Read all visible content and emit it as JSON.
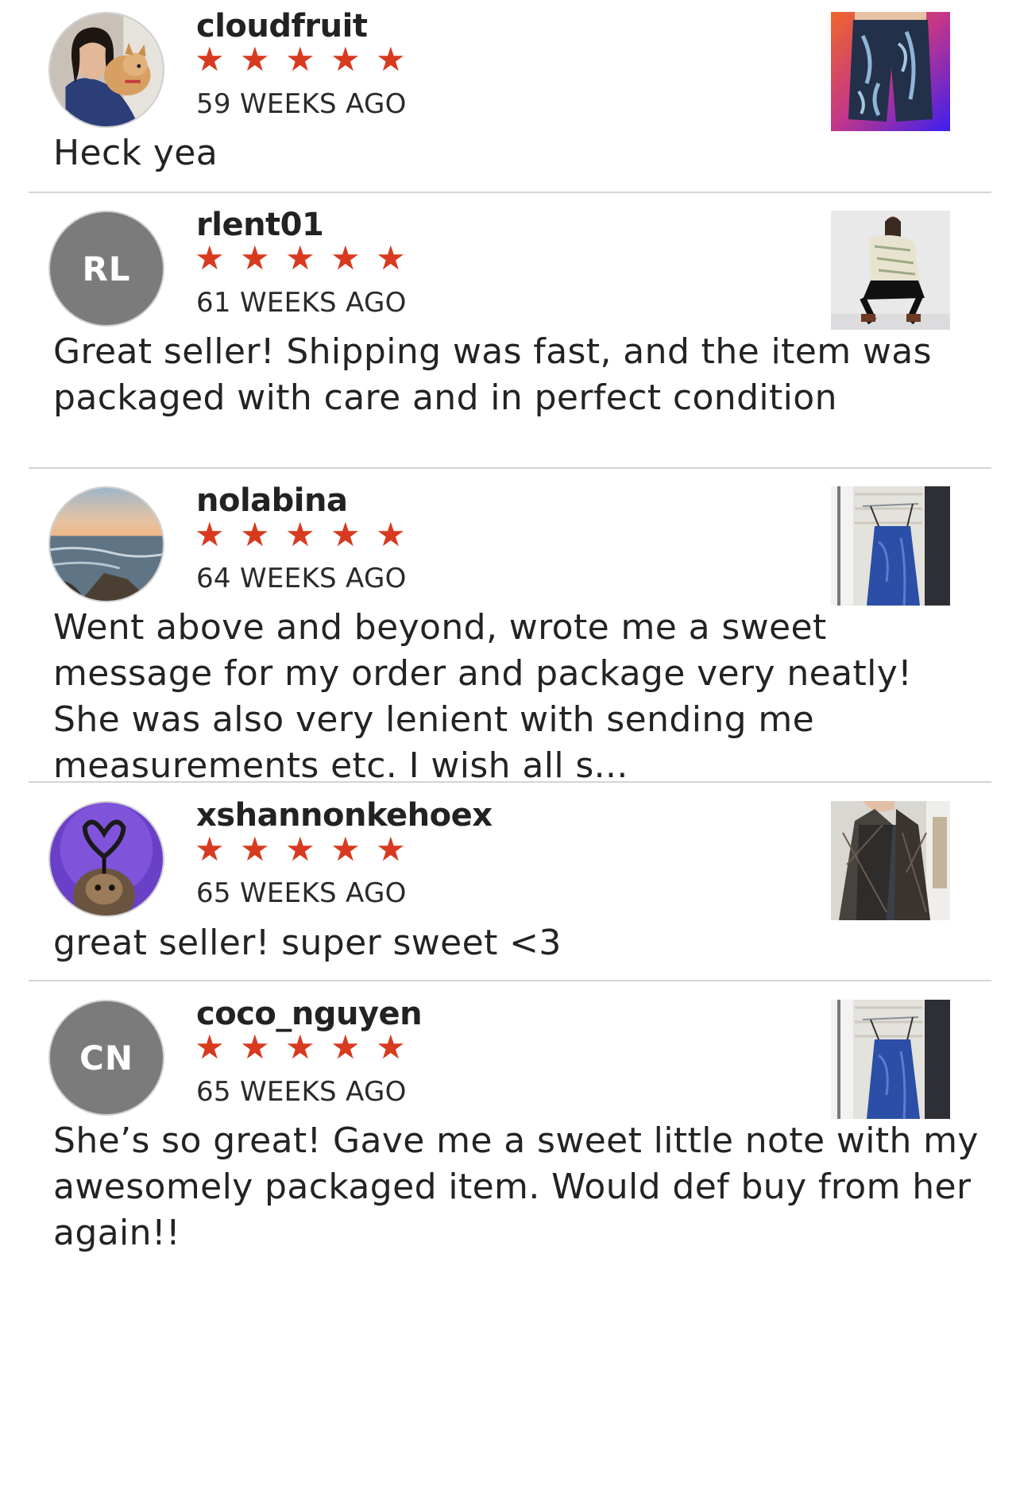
{
  "reviews": [
    {
      "username": "cloudfruit",
      "avatar": {
        "type": "photo",
        "icon": "profile-photo-girl-with-dog-icon"
      },
      "rating": 5,
      "stars": [
        "★",
        "★",
        "★",
        "★",
        "★"
      ],
      "date": "59 WEEKS AGO",
      "text": "Heck yea",
      "item_thumbnail": "item-photo-printed-shorts-icon"
    },
    {
      "username": "rlent01",
      "avatar": {
        "type": "initials",
        "initials": "RL",
        "color": "#7b7b7b"
      },
      "rating": 5,
      "stars": [
        "★",
        "★",
        "★",
        "★",
        "★"
      ],
      "date": "61 WEEKS AGO",
      "text": "Great seller! Shipping was fast, and the item was packaged with care and in perfect condition",
      "item_thumbnail": "item-photo-model-crouching-icon"
    },
    {
      "username": "nolabina",
      "avatar": {
        "type": "photo",
        "icon": "profile-photo-sunset-ocean-icon"
      },
      "rating": 5,
      "stars": [
        "★",
        "★",
        "★",
        "★",
        "★"
      ],
      "date": "64 WEEKS AGO",
      "text": "Went above and beyond, wrote me a sweet message for my order and package very neatly! She was also very lenient with sending me measurements etc. I wish all s...",
      "item_thumbnail": "item-photo-blue-slip-dress-icon"
    },
    {
      "username": "xshannonkehoex",
      "avatar": {
        "type": "photo",
        "icon": "profile-photo-purple-heart-icon"
      },
      "rating": 5,
      "stars": [
        "★",
        "★",
        "★",
        "★",
        "★"
      ],
      "date": "65 WEEKS AGO",
      "text": "great seller! super sweet <3",
      "item_thumbnail": "item-photo-knit-cardigan-icon"
    },
    {
      "username": "coco_nguyen",
      "avatar": {
        "type": "initials",
        "initials": "CN",
        "color": "#7b7b7b"
      },
      "rating": 5,
      "stars": [
        "★",
        "★",
        "★",
        "★",
        "★"
      ],
      "date": "65 WEEKS AGO",
      "text": "She’s so great! Gave me a sweet little note with my awesomely packaged item. Would def buy from her again!!",
      "item_thumbnail": "item-photo-blue-slip-dress-icon"
    }
  ],
  "colors": {
    "star": "#d83a1f",
    "divider": "#d4d4d4",
    "initials_avatar": "#7b7b7b"
  }
}
